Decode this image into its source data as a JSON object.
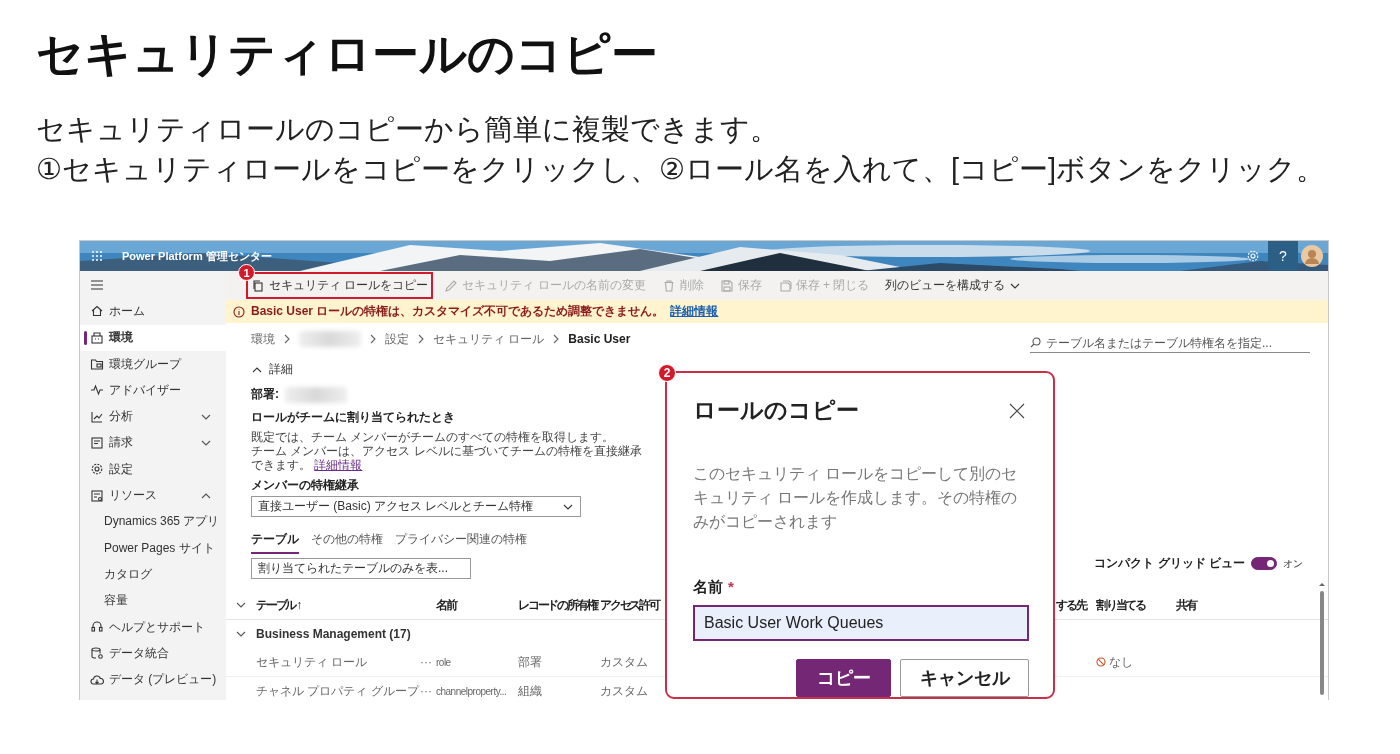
{
  "slide": {
    "title": "セキュリティロールのコピー",
    "lines": [
      "セキュリティロールのコピーから簡単に複製できます。",
      "①セキュリティロールをコピーをクリックし、②ロール名を入れて、[コピー]ボタンをクリック。"
    ]
  },
  "app": {
    "title": "Power Platform 管理センター",
    "help_label": "?"
  },
  "sidebar": {
    "items": [
      {
        "kind": "link",
        "label": "ホーム",
        "selected": false
      },
      {
        "kind": "link",
        "label": "環境",
        "selected": true
      },
      {
        "kind": "link",
        "label": "環境グループ",
        "selected": false
      },
      {
        "kind": "link",
        "label": "アドバイザー",
        "selected": false
      },
      {
        "kind": "group",
        "label": "分析",
        "selected": false,
        "expanded": false
      },
      {
        "kind": "group",
        "label": "請求",
        "selected": false,
        "expanded": false
      },
      {
        "kind": "link",
        "label": "設定",
        "selected": false
      },
      {
        "kind": "group",
        "label": "リソース",
        "selected": false,
        "expanded": true,
        "children": [
          {
            "label": "Dynamics 365 アプリ",
            "selected": false
          },
          {
            "label": "Power Pages サイト",
            "selected": false
          },
          {
            "label": "カタログ",
            "selected": false
          },
          {
            "label": "容量",
            "selected": false
          }
        ]
      },
      {
        "kind": "link",
        "label": "ヘルプとサポート",
        "selected": false
      },
      {
        "kind": "link",
        "label": "データ統合",
        "selected": false
      },
      {
        "kind": "link",
        "label": "データ (プレビュー)",
        "selected": false
      }
    ]
  },
  "commands": [
    {
      "kind": "button",
      "label": "セキュリティ ロールをコピー",
      "disabled": false,
      "callout": "1"
    },
    {
      "kind": "button",
      "label": "セキュリティ ロールの名前の変更",
      "disabled": true
    },
    {
      "kind": "button",
      "label": "削除",
      "disabled": true
    },
    {
      "kind": "button",
      "label": "保存",
      "disabled": true
    },
    {
      "kind": "button",
      "label": "保存 + 閉じる",
      "disabled": true
    },
    {
      "kind": "menu",
      "label": "列のビューを構成する",
      "disabled": false
    }
  ],
  "notice": {
    "text": "Basic User ロールの特権は、カスタマイズ不可であるため調整できません。",
    "link": "詳細情報"
  },
  "breadcrumb": [
    {
      "kind": "text",
      "label": "環境"
    },
    {
      "kind": "redacted"
    },
    {
      "kind": "text",
      "label": "設定"
    },
    {
      "kind": "text",
      "label": "セキュリティ ロール"
    },
    {
      "kind": "current",
      "label": "Basic User"
    }
  ],
  "search": {
    "placeholder": "テーブル名またはテーブル特権名を指定..."
  },
  "details": {
    "heading": "詳細",
    "expanded": true,
    "business_unit_label": "部署:",
    "team_heading": "ロールがチームに割り当てられたとき",
    "team_lines": [
      "既定では、チーム メンバーがチームのすべての特権を取得します。",
      "チーム メンバーは、アクセス レベルに基づいてチームの特権を直接継承できます。"
    ],
    "team_link": "詳細情報",
    "inherit_label": "メンバーの特権継承",
    "inherit_value": "直接ユーザー (Basic) アクセス レベルとチーム特権"
  },
  "tabs": [
    {
      "label": "テーブル",
      "selected": true
    },
    {
      "label": "その他の特権",
      "selected": false
    },
    {
      "label": "プライバシー関連の特権",
      "selected": false
    }
  ],
  "filter": {
    "value": "割り当てられたテーブルのみを表..."
  },
  "compact_view": {
    "label": "コンパクト グリッド ビュー",
    "on": true,
    "state_text": "オン"
  },
  "table": {
    "columns": [
      "テーブル ↑",
      "名前",
      "レコードの所有権",
      "アクセス許可",
      "する先",
      "割り当てる",
      "共有"
    ],
    "groups": [
      {
        "label": "Business Management (17)",
        "expanded": true,
        "rows": [
          {
            "cells": [
              "セキュリティ ロール",
              "···",
              "role",
              "部署",
              "カスタム"
            ],
            "assign": "なし"
          },
          {
            "cells": [
              "チャネル プロパティ グループ",
              "···",
              "channelproperty...",
              "組織",
              "カスタム"
            ]
          }
        ]
      }
    ]
  },
  "dialog": {
    "callout": "2",
    "title": "ロールのコピー",
    "text": "このセキュリティ ロールをコピーして別のセキュリティ ロールを作成します。その特権のみがコピーされます",
    "name_label": "名前",
    "required_mark": "*",
    "name_value": "Basic User Work Queues",
    "buttons": [
      {
        "kind": "primary",
        "label": "コピー"
      },
      {
        "kind": "secondary",
        "label": "キャンセル"
      }
    ]
  }
}
